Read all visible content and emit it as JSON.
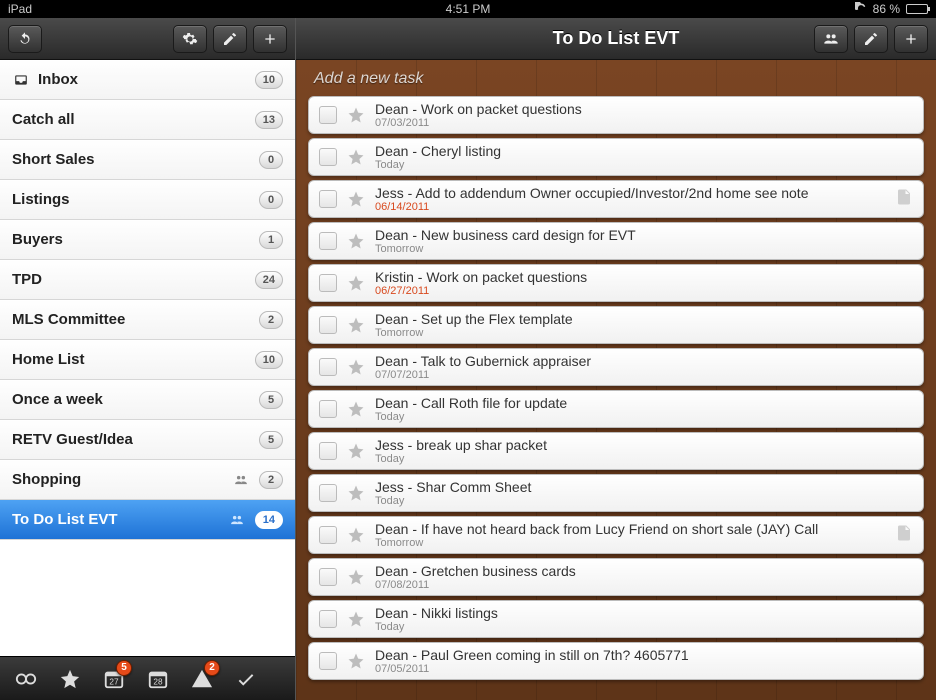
{
  "status": {
    "device": "iPad",
    "time": "4:51 PM",
    "battery_pct": "86 %",
    "sync_icon": "sync-icon"
  },
  "sidebar": {
    "toolbar": {
      "refresh": "refresh-icon",
      "settings": "gear-icon",
      "edit": "pencil-icon",
      "add": "plus-icon"
    },
    "items": [
      {
        "label": "Inbox",
        "count": "10",
        "icon": "inbox",
        "shared": false,
        "active": false
      },
      {
        "label": "Catch all",
        "count": "13",
        "icon": null,
        "shared": false,
        "active": false
      },
      {
        "label": "Short Sales",
        "count": "0",
        "icon": null,
        "shared": false,
        "active": false
      },
      {
        "label": "Listings",
        "count": "0",
        "icon": null,
        "shared": false,
        "active": false
      },
      {
        "label": "Buyers",
        "count": "1",
        "icon": null,
        "shared": false,
        "active": false
      },
      {
        "label": "TPD",
        "count": "24",
        "icon": null,
        "shared": false,
        "active": false
      },
      {
        "label": "MLS Committee",
        "count": "2",
        "icon": null,
        "shared": false,
        "active": false
      },
      {
        "label": "Home List",
        "count": "10",
        "icon": null,
        "shared": false,
        "active": false
      },
      {
        "label": "Once a week",
        "count": "5",
        "icon": null,
        "shared": false,
        "active": false
      },
      {
        "label": "RETV Guest/Idea",
        "count": "5",
        "icon": null,
        "shared": false,
        "active": false
      },
      {
        "label": "Shopping",
        "count": "2",
        "icon": null,
        "shared": true,
        "active": false
      },
      {
        "label": "To Do List EVT",
        "count": "14",
        "icon": null,
        "shared": true,
        "active": true
      }
    ],
    "bottom": [
      {
        "name": "all-icon",
        "badge": null
      },
      {
        "name": "starred-icon",
        "badge": null
      },
      {
        "name": "today-icon",
        "badge": "5",
        "caption": "27"
      },
      {
        "name": "tomorrow-icon",
        "badge": null,
        "caption": "28"
      },
      {
        "name": "overdue-icon",
        "badge": "2"
      },
      {
        "name": "done-icon",
        "badge": null
      }
    ]
  },
  "main": {
    "title": "To Do List EVT",
    "toolbar": {
      "share": "people-icon",
      "edit": "pencil-icon",
      "add": "plus-icon"
    },
    "add_placeholder": "Add a new task",
    "tasks": [
      {
        "title": "Dean - Work on packet questions",
        "date": "07/03/2011",
        "overdue": false,
        "note": false
      },
      {
        "title": "Dean - Cheryl listing",
        "date": "Today",
        "overdue": false,
        "note": false
      },
      {
        "title": "Jess - Add to addendum Owner occupied/Investor/2nd home see note",
        "date": "06/14/2011",
        "overdue": true,
        "note": true
      },
      {
        "title": "Dean - New business card design for EVT",
        "date": "Tomorrow",
        "overdue": false,
        "note": false
      },
      {
        "title": "Kristin - Work on packet questions",
        "date": "06/27/2011",
        "overdue": true,
        "note": false
      },
      {
        "title": "Dean - Set up the Flex template",
        "date": "Tomorrow",
        "overdue": false,
        "note": false
      },
      {
        "title": "Dean - Talk to Gubernick appraiser",
        "date": "07/07/2011",
        "overdue": false,
        "note": false
      },
      {
        "title": "Dean - Call Roth file for update",
        "date": "Today",
        "overdue": false,
        "note": false
      },
      {
        "title": "Jess - break up shar packet",
        "date": "Today",
        "overdue": false,
        "note": false
      },
      {
        "title": "Jess - Shar Comm Sheet",
        "date": "Today",
        "overdue": false,
        "note": false
      },
      {
        "title": "Dean - If have not heard back from Lucy Friend on short sale (JAY) Call",
        "date": "Tomorrow",
        "overdue": false,
        "note": true
      },
      {
        "title": "Dean - Gretchen business cards",
        "date": "07/08/2011",
        "overdue": false,
        "note": false
      },
      {
        "title": "Dean - Nikki listings",
        "date": "Today",
        "overdue": false,
        "note": false
      },
      {
        "title": "Dean - Paul Green coming in still on 7th? 4605771",
        "date": "07/05/2011",
        "overdue": false,
        "note": false
      }
    ]
  }
}
